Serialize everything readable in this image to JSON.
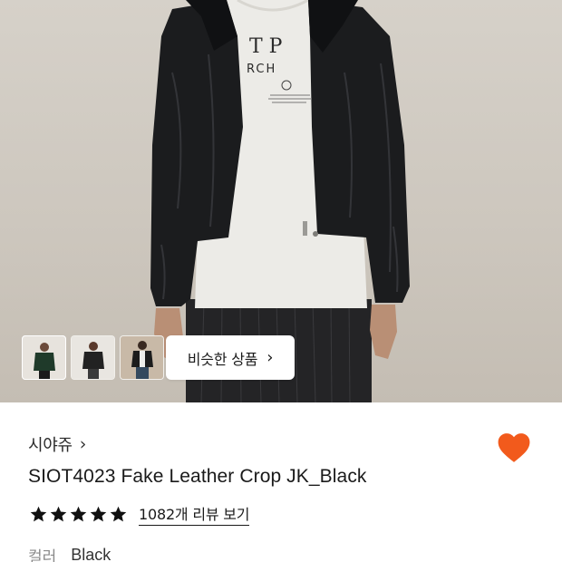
{
  "hero": {
    "thumbnails": [
      {
        "name": "thumb-1",
        "active": true
      },
      {
        "name": "thumb-2",
        "active": false
      },
      {
        "name": "thumb-3",
        "active": false
      }
    ],
    "similar_button_label": "비슷한 상품",
    "similar_button_icon": "chevron-right-icon",
    "tshirt_print_line1": "T P",
    "tshirt_print_line2": "RCH"
  },
  "product": {
    "brand": "시야쥬",
    "brand_icon": "chevron-right-icon",
    "title": "SIOT4023 Fake Leather Crop JK_Black",
    "wishlist_icon": "heart-icon",
    "wishlist_color": "#f25a1c",
    "rating": {
      "stars": 5,
      "review_link": "1082개 리뷰 보기"
    },
    "color": {
      "label": "컬러",
      "value": "Black"
    }
  }
}
